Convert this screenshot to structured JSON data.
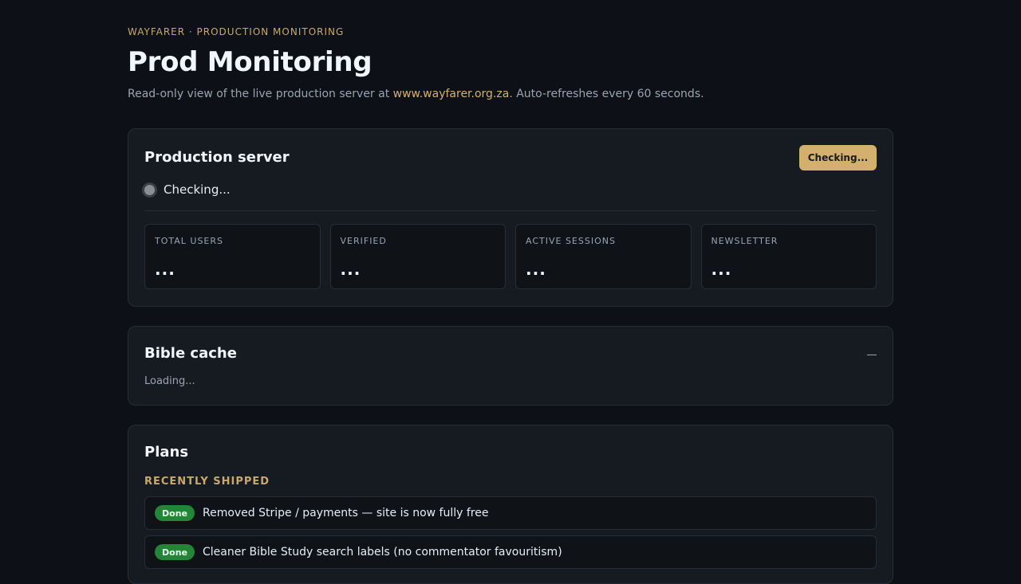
{
  "header": {
    "eyebrow": "WAYFARER · PRODUCTION MONITORING",
    "title": "Prod Monitoring",
    "subtitle_pre": "Read-only view of the live production server at ",
    "subtitle_link": "www.wayfarer.org.za",
    "subtitle_post": ". Auto-refreshes every 60 seconds."
  },
  "production": {
    "title": "Production server",
    "check_button": "Checking...",
    "status_text": "Checking...",
    "status_icon": "status-dot-icon",
    "stats": [
      {
        "label": "TOTAL USERS",
        "value": "..."
      },
      {
        "label": "VERIFIED",
        "value": "..."
      },
      {
        "label": "ACTIVE SESSIONS",
        "value": "..."
      },
      {
        "label": "NEWSLETTER",
        "value": "..."
      }
    ]
  },
  "bible_cache": {
    "title": "Bible cache",
    "collapse_icon": "minus-icon",
    "loading_text": "Loading..."
  },
  "plans": {
    "title": "Plans",
    "section_label": "RECENTLY SHIPPED",
    "items": [
      {
        "badge": "Done",
        "text": "Removed Stripe / payments — site is now fully free"
      },
      {
        "badge": "Done",
        "text": "Cleaner Bible Study search labels (no commentator favouritism)"
      }
    ]
  },
  "colors": {
    "background": "#0d1117",
    "card": "#161b22",
    "accent": "#d4b06e",
    "done_badge": "#238636"
  }
}
